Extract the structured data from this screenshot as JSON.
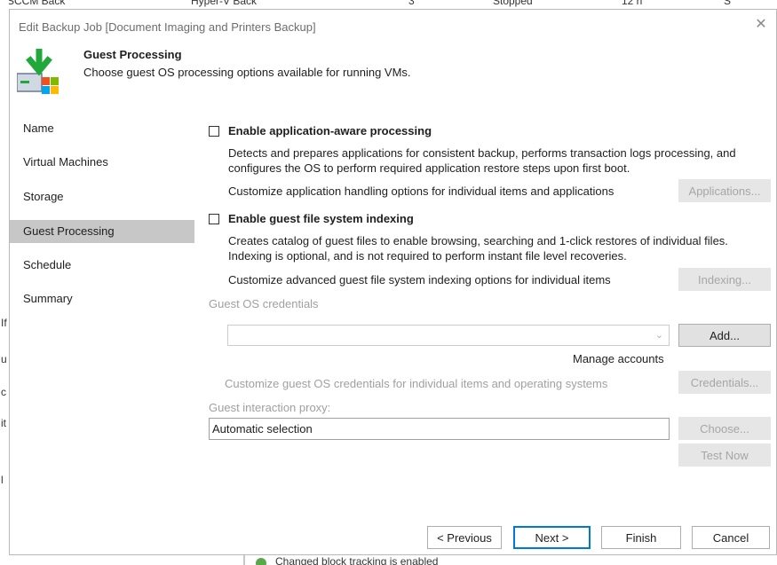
{
  "background": {
    "top_fragments": [
      "SCCM Back",
      "Hyper-V Back",
      "3",
      "Stopped",
      "12 h",
      "S"
    ],
    "left_fragments": [
      "If",
      "u",
      "c",
      "it",
      "l"
    ],
    "bottom_text": "Changed block tracking is enabled"
  },
  "dialog": {
    "title": "Edit Backup Job [Document Imaging and Printers Backup]",
    "close_glyph": "✕",
    "header": {
      "title": "Guest Processing",
      "subtitle": "Choose guest OS processing options available for running VMs."
    }
  },
  "nav": {
    "items": [
      {
        "label": "Name",
        "active": false
      },
      {
        "label": "Virtual Machines",
        "active": false
      },
      {
        "label": "Storage",
        "active": false
      },
      {
        "label": "Guest Processing",
        "active": true
      },
      {
        "label": "Schedule",
        "active": false
      },
      {
        "label": "Summary",
        "active": false
      }
    ]
  },
  "content": {
    "app_aware": {
      "label": "Enable application-aware processing",
      "checked": false,
      "desc_line1": "Detects and prepares applications for consistent backup, performs transaction logs processing, and",
      "desc_line2": "configures the OS to perform required application restore steps upon first boot.",
      "customize": "Customize application handling options for individual items and applications",
      "button": "Applications..."
    },
    "indexing": {
      "label": "Enable guest file system indexing",
      "checked": false,
      "desc_line1": "Creates catalog of guest files to enable browsing, searching and 1-click restores of individual files.",
      "desc_line2": "Indexing is optional, and is not required to perform instant file level recoveries.",
      "customize": "Customize advanced guest file system indexing options for individual items",
      "button": "Indexing..."
    },
    "credentials": {
      "label": "Guest OS credentials",
      "combo_value": "",
      "add_button": "Add...",
      "manage_link": "Manage accounts",
      "customize": "Customize guest OS credentials for individual items and operating systems",
      "button": "Credentials..."
    },
    "proxy": {
      "label": "Guest interaction proxy:",
      "value": "Automatic selection",
      "choose_button": "Choose...",
      "test_button": "Test Now"
    }
  },
  "footer": {
    "previous": "< Previous",
    "next": "Next >",
    "finish": "Finish",
    "cancel": "Cancel"
  },
  "colors": {
    "accent": "#0078d7",
    "active_nav": "#c7c7c7",
    "disabled_text": "#a0a0a0",
    "icon_green": "#22a83a"
  }
}
